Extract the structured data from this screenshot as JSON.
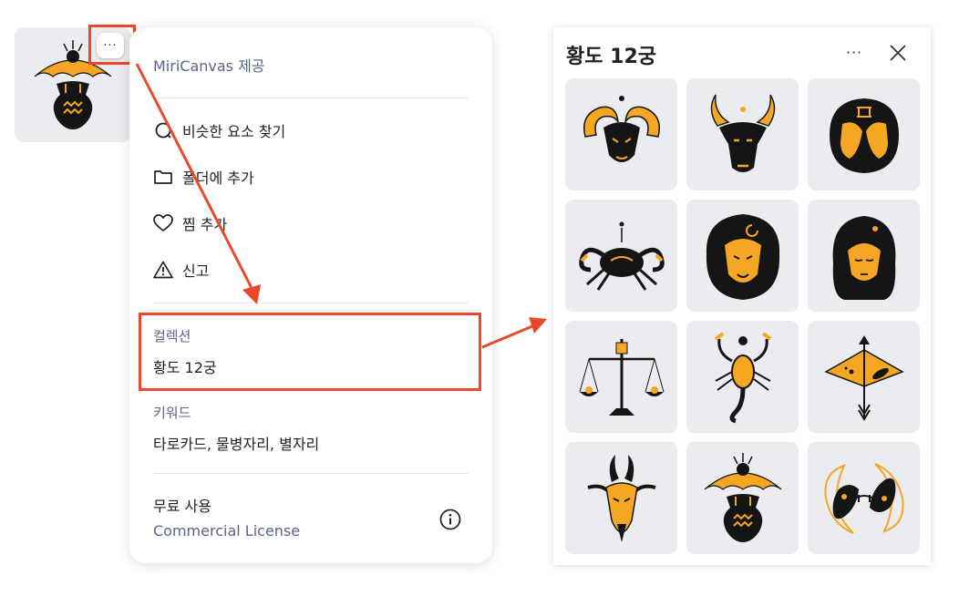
{
  "thumbnail": {
    "more_label": "···"
  },
  "menu": {
    "provider": "MiriCanvas 제공",
    "items": [
      {
        "label": "비슷한 요소 찾기",
        "icon": "search-icon"
      },
      {
        "label": "폴더에 추가",
        "icon": "folder-icon"
      },
      {
        "label": "찜 추가",
        "icon": "heart-icon"
      },
      {
        "label": "신고",
        "icon": "warning-icon"
      }
    ],
    "collection": {
      "label": "컬렉션",
      "value": "황도 12궁"
    },
    "keywords": {
      "label": "키워드",
      "value": "타로카드, 물병자리, 별자리"
    },
    "license": {
      "label": "무료 사용",
      "link": "Commercial License"
    }
  },
  "panel": {
    "title": "황도 12궁",
    "more_label": "···",
    "tiles": [
      "aries-icon",
      "taurus-icon",
      "gemini-icon",
      "cancer-icon",
      "leo-icon",
      "virgo-icon",
      "libra-icon",
      "scorpio-icon",
      "sagittarius-icon",
      "capricorn-icon",
      "aquarius-icon",
      "pisces-icon"
    ]
  },
  "colors": {
    "accent_orange": "#f5a623",
    "ink": "#151515",
    "highlight": "#e8492c",
    "muted": "#5b6387"
  }
}
